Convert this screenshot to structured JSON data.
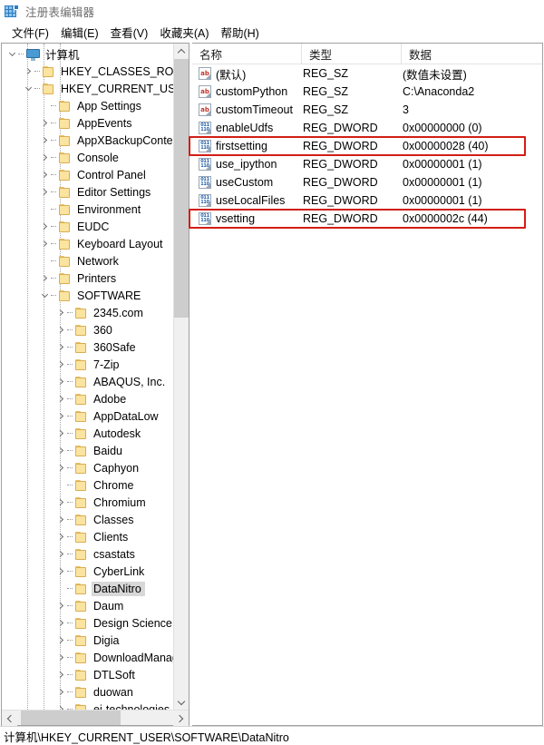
{
  "window": {
    "title": "注册表编辑器",
    "app_icon": "registry-editor-icon"
  },
  "menubar": {
    "items": [
      {
        "label": "文件(F)",
        "name": "menu-file"
      },
      {
        "label": "编辑(E)",
        "name": "menu-edit"
      },
      {
        "label": "查看(V)",
        "name": "menu-view"
      },
      {
        "label": "收藏夹(A)",
        "name": "menu-favorites"
      },
      {
        "label": "帮助(H)",
        "name": "menu-help"
      }
    ]
  },
  "tree": {
    "nodes": [
      {
        "label": "计算机",
        "depth": 0,
        "state": "expanded",
        "icon": "computer-icon",
        "selected": false
      },
      {
        "label": "HKEY_CLASSES_ROOT",
        "depth": 1,
        "state": "collapsed",
        "icon": "folder-icon",
        "selected": false
      },
      {
        "label": "HKEY_CURRENT_USER",
        "depth": 1,
        "state": "expanded",
        "icon": "folder-icon",
        "selected": false
      },
      {
        "label": "App Settings",
        "depth": 2,
        "state": "leaf",
        "icon": "folder-icon",
        "selected": false
      },
      {
        "label": "AppEvents",
        "depth": 2,
        "state": "collapsed",
        "icon": "folder-icon",
        "selected": false
      },
      {
        "label": "AppXBackupContent",
        "depth": 2,
        "state": "collapsed",
        "icon": "folder-icon",
        "selected": false
      },
      {
        "label": "Console",
        "depth": 2,
        "state": "collapsed",
        "icon": "folder-icon",
        "selected": false
      },
      {
        "label": "Control Panel",
        "depth": 2,
        "state": "collapsed",
        "icon": "folder-icon",
        "selected": false
      },
      {
        "label": "Editor Settings",
        "depth": 2,
        "state": "collapsed",
        "icon": "folder-icon",
        "selected": false
      },
      {
        "label": "Environment",
        "depth": 2,
        "state": "leaf",
        "icon": "folder-icon",
        "selected": false
      },
      {
        "label": "EUDC",
        "depth": 2,
        "state": "collapsed",
        "icon": "folder-icon",
        "selected": false
      },
      {
        "label": "Keyboard Layout",
        "depth": 2,
        "state": "collapsed",
        "icon": "folder-icon",
        "selected": false
      },
      {
        "label": "Network",
        "depth": 2,
        "state": "leaf",
        "icon": "folder-icon",
        "selected": false
      },
      {
        "label": "Printers",
        "depth": 2,
        "state": "collapsed",
        "icon": "folder-icon",
        "selected": false
      },
      {
        "label": "SOFTWARE",
        "depth": 2,
        "state": "expanded",
        "icon": "folder-icon",
        "selected": false
      },
      {
        "label": "2345.com",
        "depth": 3,
        "state": "collapsed",
        "icon": "folder-icon",
        "selected": false
      },
      {
        "label": "360",
        "depth": 3,
        "state": "collapsed",
        "icon": "folder-icon",
        "selected": false
      },
      {
        "label": "360Safe",
        "depth": 3,
        "state": "collapsed",
        "icon": "folder-icon",
        "selected": false
      },
      {
        "label": "7-Zip",
        "depth": 3,
        "state": "collapsed",
        "icon": "folder-icon",
        "selected": false
      },
      {
        "label": "ABAQUS, Inc.",
        "depth": 3,
        "state": "collapsed",
        "icon": "folder-icon",
        "selected": false
      },
      {
        "label": "Adobe",
        "depth": 3,
        "state": "collapsed",
        "icon": "folder-icon",
        "selected": false
      },
      {
        "label": "AppDataLow",
        "depth": 3,
        "state": "collapsed",
        "icon": "folder-icon",
        "selected": false
      },
      {
        "label": "Autodesk",
        "depth": 3,
        "state": "collapsed",
        "icon": "folder-icon",
        "selected": false
      },
      {
        "label": "Baidu",
        "depth": 3,
        "state": "collapsed",
        "icon": "folder-icon",
        "selected": false
      },
      {
        "label": "Caphyon",
        "depth": 3,
        "state": "collapsed",
        "icon": "folder-icon",
        "selected": false
      },
      {
        "label": "Chrome",
        "depth": 3,
        "state": "leaf",
        "icon": "folder-icon",
        "selected": false
      },
      {
        "label": "Chromium",
        "depth": 3,
        "state": "collapsed",
        "icon": "folder-icon",
        "selected": false
      },
      {
        "label": "Classes",
        "depth": 3,
        "state": "collapsed",
        "icon": "folder-icon",
        "selected": false
      },
      {
        "label": "Clients",
        "depth": 3,
        "state": "collapsed",
        "icon": "folder-icon",
        "selected": false
      },
      {
        "label": "csastats",
        "depth": 3,
        "state": "collapsed",
        "icon": "folder-icon",
        "selected": false
      },
      {
        "label": "CyberLink",
        "depth": 3,
        "state": "collapsed",
        "icon": "folder-icon",
        "selected": false
      },
      {
        "label": "DataNitro",
        "depth": 3,
        "state": "leaf",
        "icon": "folder-icon",
        "selected": true
      },
      {
        "label": "Daum",
        "depth": 3,
        "state": "collapsed",
        "icon": "folder-icon",
        "selected": false
      },
      {
        "label": "Design Science",
        "depth": 3,
        "state": "collapsed",
        "icon": "folder-icon",
        "selected": false
      },
      {
        "label": "Digia",
        "depth": 3,
        "state": "collapsed",
        "icon": "folder-icon",
        "selected": false
      },
      {
        "label": "DownloadManag",
        "depth": 3,
        "state": "collapsed",
        "icon": "folder-icon",
        "selected": false
      },
      {
        "label": "DTLSoft",
        "depth": 3,
        "state": "collapsed",
        "icon": "folder-icon",
        "selected": false
      },
      {
        "label": "duowan",
        "depth": 3,
        "state": "collapsed",
        "icon": "folder-icon",
        "selected": false
      },
      {
        "label": "ei-technologies",
        "depth": 3,
        "state": "collapsed",
        "icon": "folder-icon",
        "selected": false
      }
    ]
  },
  "list": {
    "columns": [
      {
        "label": "名称",
        "name": "column-name"
      },
      {
        "label": "类型",
        "name": "column-type"
      },
      {
        "label": "数据",
        "name": "column-data"
      }
    ],
    "rows": [
      {
        "name": "(默认)",
        "type": "REG_SZ",
        "data": "(数值未设置)",
        "icon": "string-value-icon",
        "highlighted": false
      },
      {
        "name": "customPython",
        "type": "REG_SZ",
        "data": "C:\\Anaconda2",
        "icon": "string-value-icon",
        "highlighted": false
      },
      {
        "name": "customTimeout",
        "type": "REG_SZ",
        "data": "3",
        "icon": "string-value-icon",
        "highlighted": false
      },
      {
        "name": "enableUdfs",
        "type": "REG_DWORD",
        "data": "0x00000000 (0)",
        "icon": "dword-value-icon",
        "highlighted": false
      },
      {
        "name": "firstsetting",
        "type": "REG_DWORD",
        "data": "0x00000028 (40)",
        "icon": "dword-value-icon",
        "highlighted": true
      },
      {
        "name": "use_ipython",
        "type": "REG_DWORD",
        "data": "0x00000001 (1)",
        "icon": "dword-value-icon",
        "highlighted": false
      },
      {
        "name": "useCustom",
        "type": "REG_DWORD",
        "data": "0x00000001 (1)",
        "icon": "dword-value-icon",
        "highlighted": false
      },
      {
        "name": "useLocalFiles",
        "type": "REG_DWORD",
        "data": "0x00000001 (1)",
        "icon": "dword-value-icon",
        "highlighted": false
      },
      {
        "name": "vsetting",
        "type": "REG_DWORD",
        "data": "0x0000002c (44)",
        "icon": "dword-value-icon",
        "highlighted": true
      }
    ],
    "icon_text": {
      "string": "ab",
      "dword_top": "011",
      "dword_bottom": "110"
    }
  },
  "annotations": {
    "color": "#d21e14",
    "boxes": [
      {
        "target_value": "firstsetting"
      },
      {
        "target_value": "vsetting"
      }
    ]
  },
  "statusbar": {
    "path": "计算机\\HKEY_CURRENT_USER\\SOFTWARE\\DataNitro"
  }
}
